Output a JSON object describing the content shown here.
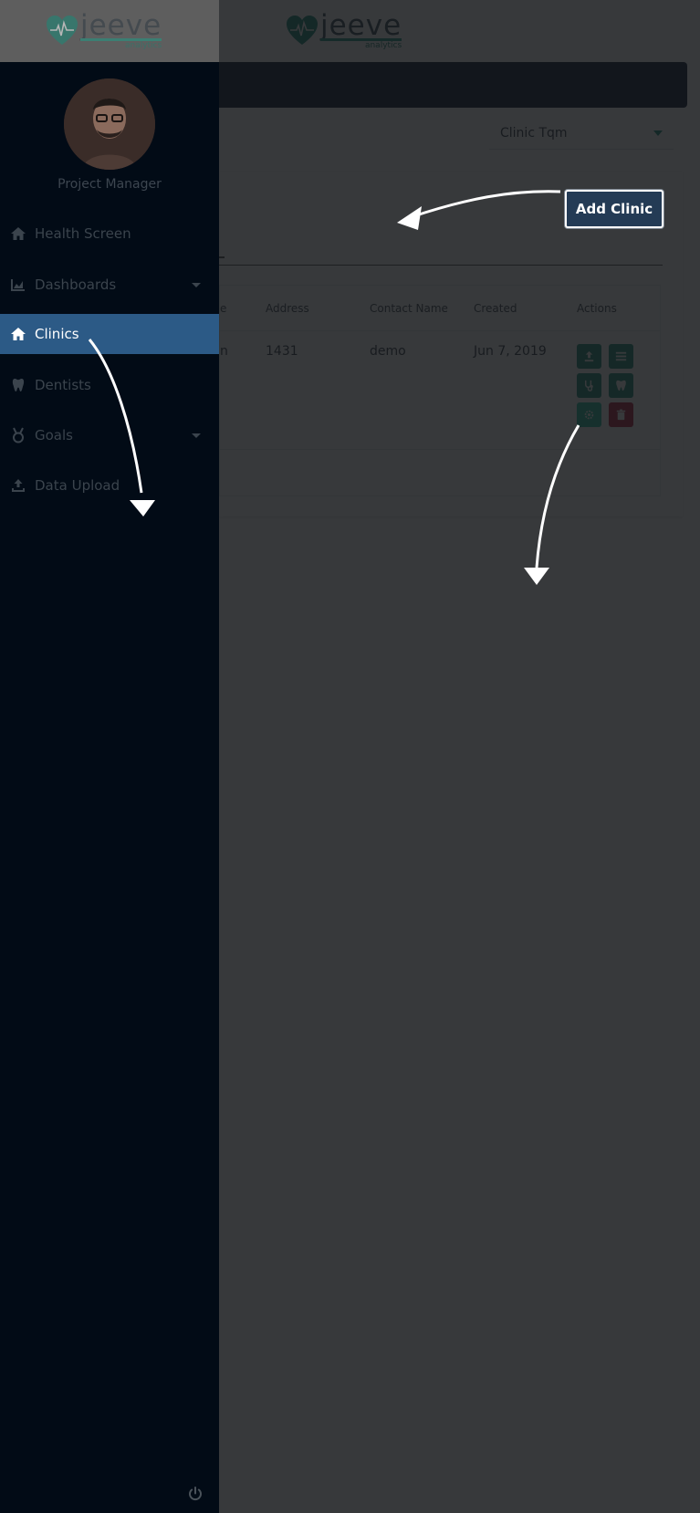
{
  "header": {
    "logo_main": "jeeve",
    "logo_sub": "analytics"
  },
  "clinic_selector": {
    "selected": "Clinic Tqm"
  },
  "card": {
    "add_button_label": "Add Clinic",
    "table": {
      "headers": {
        "name": "e",
        "address": "Address",
        "contact": "Contact Name",
        "created": "Created",
        "actions": "Actions"
      },
      "rows": [
        {
          "name": "n",
          "address": "1431",
          "contact": "demo",
          "created": "Jun 7, 2019"
        }
      ]
    }
  },
  "sidebar": {
    "role": "Project Manager",
    "items": [
      {
        "label": "Health Screen",
        "icon": "home-icon"
      },
      {
        "label": "Dashboards",
        "icon": "chart-icon",
        "has_submenu": true
      },
      {
        "label": "Clinics",
        "icon": "home-icon",
        "active": true
      },
      {
        "label": "Dentists",
        "icon": "tooth-icon"
      },
      {
        "label": "Goals",
        "icon": "medal-icon",
        "has_submenu": true
      },
      {
        "label": "Data Upload",
        "icon": "upload-icon"
      }
    ]
  },
  "colors": {
    "accent": "#1e8f79",
    "active_nav": "#2c5a86",
    "danger": "#b31e3c",
    "sidebar_bg": "#020b16"
  }
}
